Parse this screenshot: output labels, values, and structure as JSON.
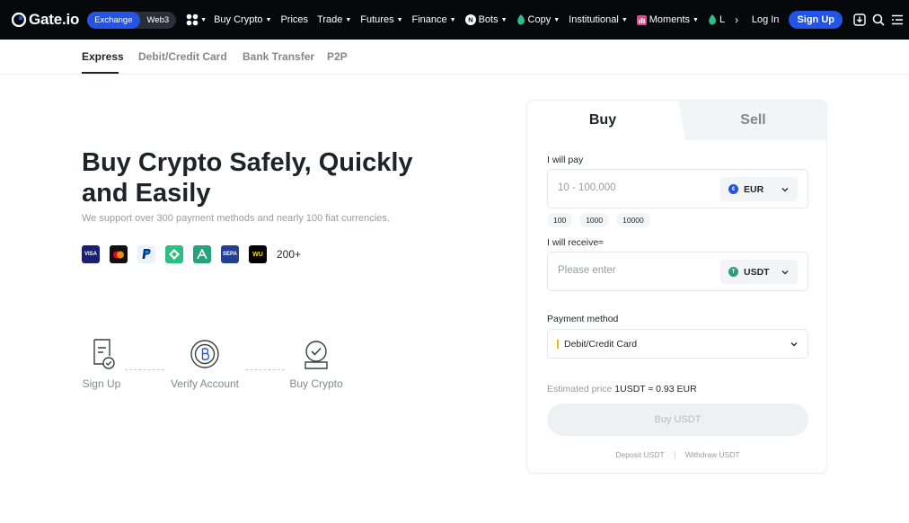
{
  "header": {
    "logo_text": "Gate.io",
    "switch": {
      "active": "Exchange",
      "inactive": "Web3"
    },
    "nav": [
      {
        "label": "Buy Crypto",
        "icon": null,
        "caret": true
      },
      {
        "label": "Prices",
        "icon": null,
        "caret": false
      },
      {
        "label": "Trade",
        "icon": null,
        "caret": true
      },
      {
        "label": "Futures",
        "icon": null,
        "caret": true
      },
      {
        "label": "Finance",
        "icon": null,
        "caret": true
      },
      {
        "label": "Bots",
        "icon": "bots-icon",
        "caret": true
      },
      {
        "label": "Copy",
        "icon": "copy-leaf-icon",
        "caret": true
      },
      {
        "label": "Institutional",
        "icon": null,
        "caret": true
      },
      {
        "label": "Moments",
        "icon": "moments-icon",
        "caret": true
      },
      {
        "label": "L",
        "icon": "launch-leaf-icon",
        "caret": false
      }
    ],
    "login": "Log In",
    "signup": "Sign Up",
    "colors": {
      "bg": "#06080b",
      "accent": "#2354e6"
    }
  },
  "subtabs": [
    "Express",
    "Debit/Credit Card",
    "Bank Transfer",
    "P2P"
  ],
  "hero": {
    "title": "Buy Crypto Safely, Quickly and Easily",
    "subtitle": "We support over 300 payment methods and nearly 100 fiat currencies.",
    "payment_icons": [
      "visa-icon",
      "mastercard-icon",
      "paypal-icon",
      "binance-pay-icon",
      "app-pay-icon",
      "sepa-icon",
      "western-union-icon"
    ],
    "payment_more": "200+"
  },
  "steps": [
    {
      "label": "Sign Up",
      "icon": "document-check-icon"
    },
    {
      "label": "Verify Account",
      "icon": "coin-verify-icon"
    },
    {
      "label": "Buy Crypto",
      "icon": "checkmark-badge-icon"
    }
  ],
  "card": {
    "tabs": {
      "buy": "Buy",
      "sell": "Sell"
    },
    "pay_label": "I will pay",
    "pay_placeholder": "10 - 100,000",
    "pay_currency": "EUR",
    "chips": [
      "100",
      "1000",
      "10000"
    ],
    "receive_label": "I will receive≈",
    "receive_placeholder": "Please enter",
    "receive_currency": "USDT",
    "method_label": "Payment method",
    "method_value": "Debit/Credit Card",
    "estimated_label": "Estimated price",
    "estimated_value": "1USDT ≈ 0.93 EUR",
    "buy_button": "Buy USDT",
    "deposit_link": "Deposit USDT",
    "withdraw_link": "Withdraw USDT"
  }
}
